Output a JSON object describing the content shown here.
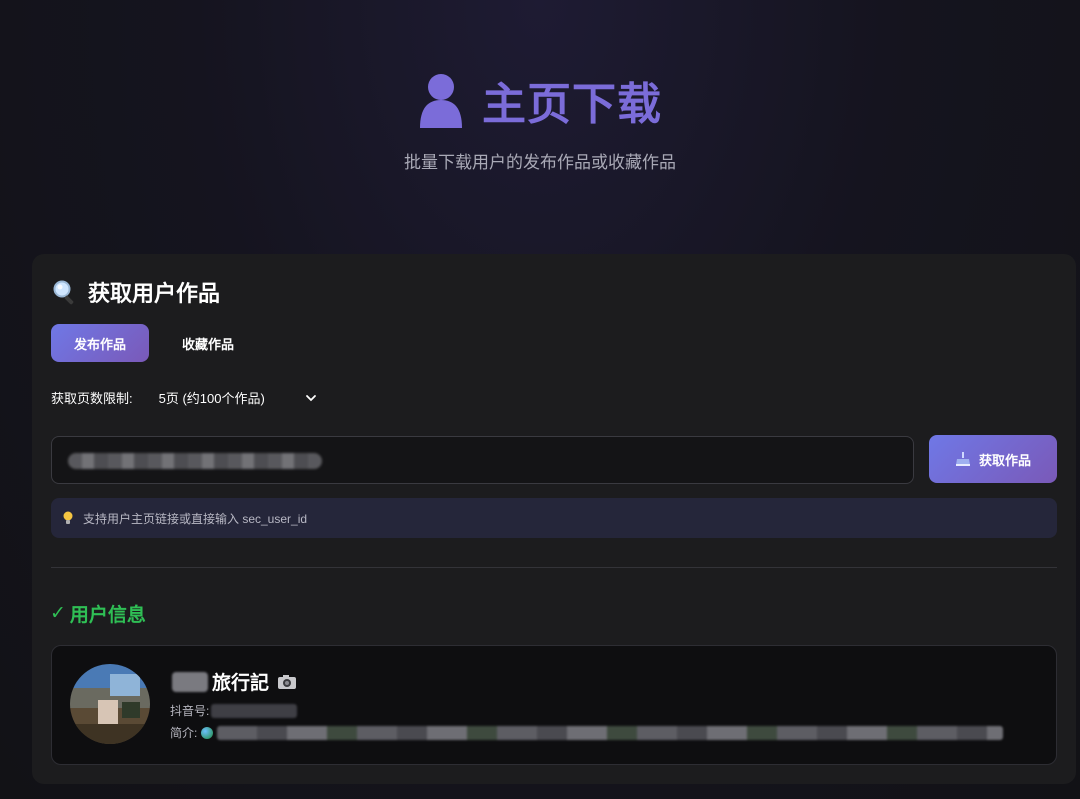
{
  "header": {
    "title": "主页下载",
    "subtitle": "批量下载用户的发布作品或收藏作品",
    "icon": "user-icon",
    "accent_color": "#7b6cd9"
  },
  "fetch_card": {
    "title": "获取用户作品",
    "title_icon": "magnifier-icon",
    "tabs": [
      {
        "label": "发布作品",
        "active": true
      },
      {
        "label": "收藏作品",
        "active": false
      }
    ],
    "page_limit_label": "获取页数限制:",
    "page_limit_value": "5页 (约100个作品)",
    "input_value": "",
    "fetch_button_label": "获取作品",
    "hint_text": "支持用户主页链接或直接输入 sec_user_id"
  },
  "user_info": {
    "section_title": "用户信息",
    "check_mark": "✓",
    "status_color": "#2fbf55",
    "name": "旅行記",
    "id_label": "抖音号:",
    "bio_label": "简介:"
  }
}
